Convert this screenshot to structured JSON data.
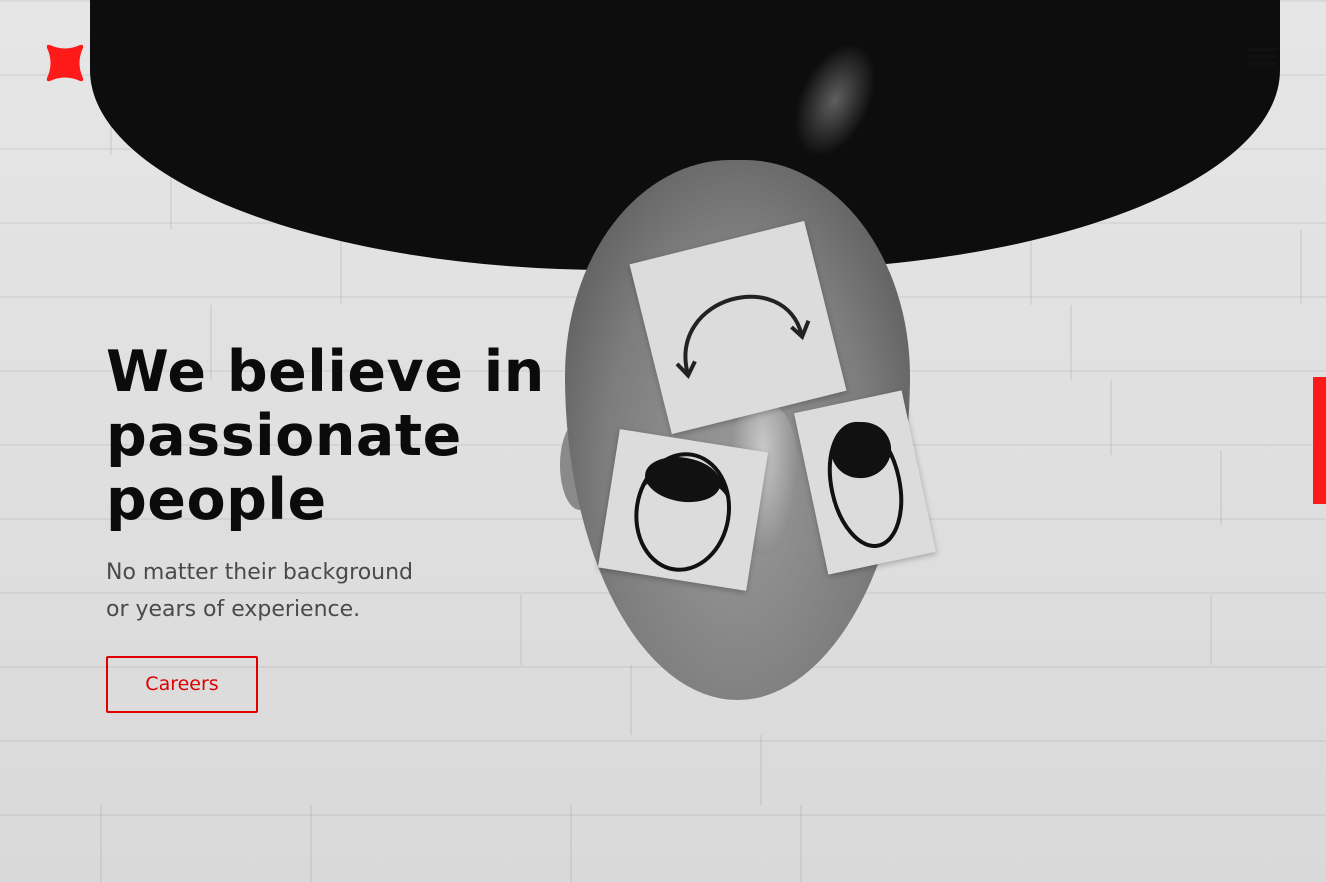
{
  "brand": {
    "logo_icon": "red-x-logo-icon",
    "accent_color": "#e00000"
  },
  "nav": {
    "menu_icon": "hamburger-menu-icon"
  },
  "hero": {
    "headline_line1": "We believe in",
    "headline_line2": "passionate",
    "headline_line3": "people",
    "subtitle_line1": "No matter their background",
    "subtitle_line2": "or years of experience.",
    "cta_label": "Careers"
  }
}
